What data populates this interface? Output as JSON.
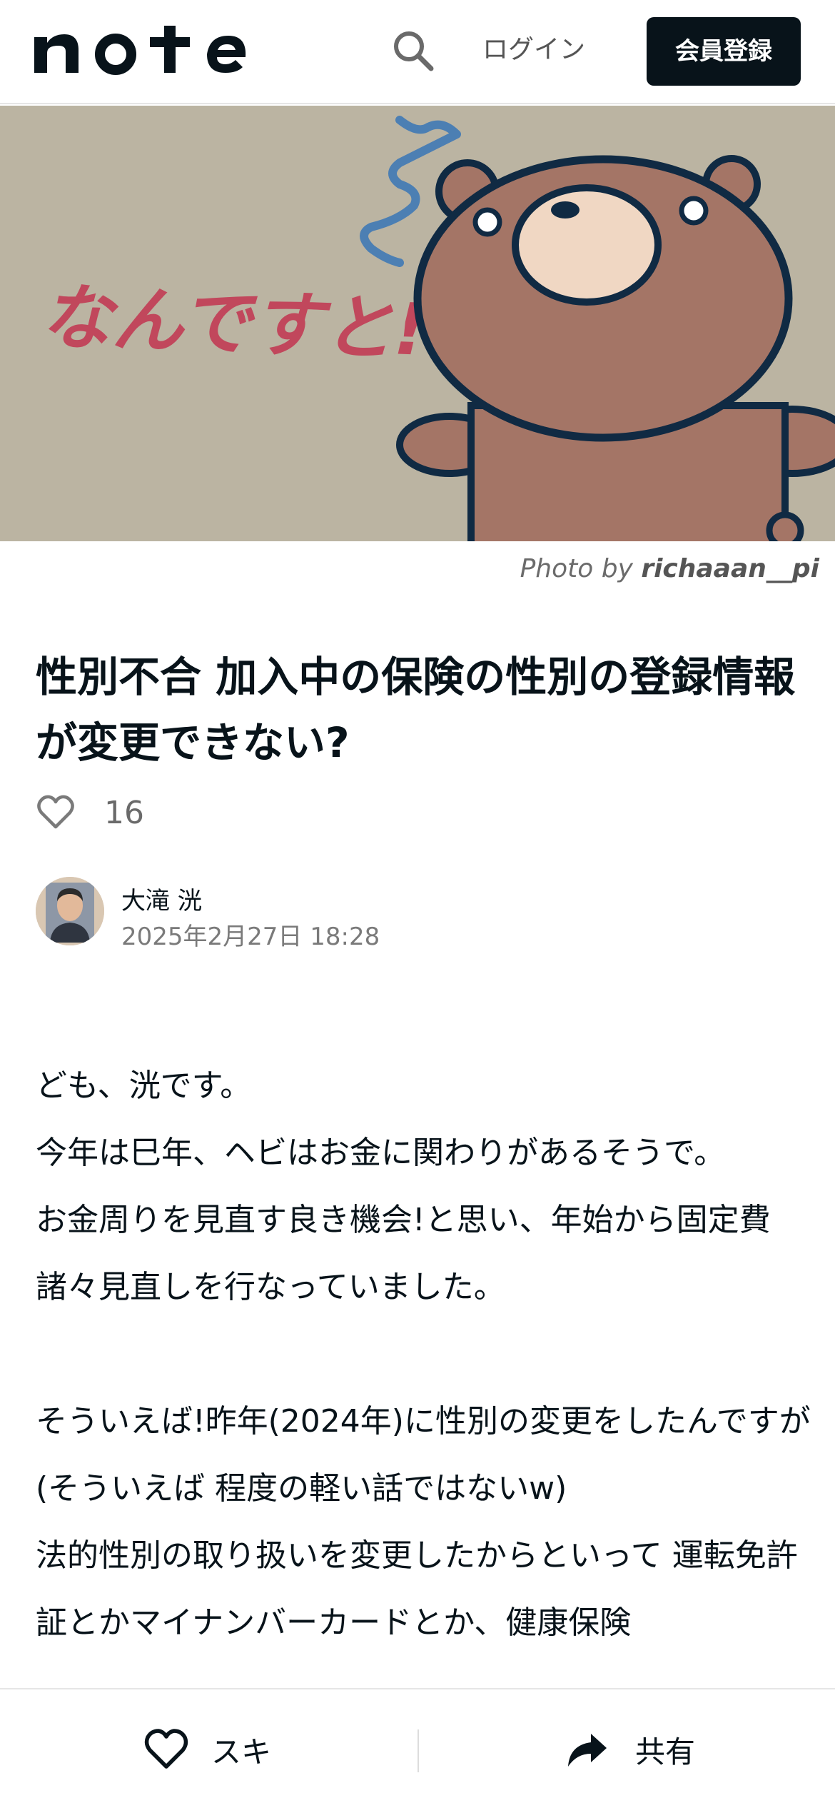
{
  "header": {
    "logo_text": "note",
    "search_icon": "search-icon",
    "login_label": "ログイン",
    "signup_label": "会員登録"
  },
  "hero": {
    "image_text": "なんですと!?",
    "credit_prefix": "Photo by ",
    "credit_author": "richaaan__pi"
  },
  "article": {
    "title": "性別不合 加入中の保険の性別の登録情報が変更できない?",
    "like_icon": "heart-outline-icon",
    "like_count": "16",
    "author_name": "大滝 洸",
    "post_date": "2025年2月27日 18:28",
    "paragraphs": [
      "ども、洸です。",
      "今年は巳年、ヘビはお金に関わりがあるそうで。",
      "お金周りを見直す良き機会!と思い、年始から固定費諸々見直しを行なっていました。",
      "",
      "そういえば!昨年(2024年)に性別の変更をしたんですが(そういえば 程度の軽い話ではないw)",
      "法的性別の取り扱いを変更したからといって 運転免許証とかマイナンバーカードとか、健康保険"
    ]
  },
  "bottom_bar": {
    "like_label": "スキ",
    "share_label": "共有"
  },
  "colors": {
    "text": "#08131a",
    "brand_button": "#08131a",
    "hero_background": "#bbb4a2",
    "bear_body": "#a47566",
    "title_red": "#c1475c"
  }
}
